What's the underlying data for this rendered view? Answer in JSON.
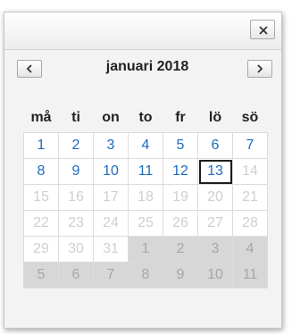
{
  "picker": {
    "month_title": "januari 2018",
    "close_icon": "close-icon",
    "prev_icon": "chevron-left-icon",
    "next_icon": "chevron-right-icon",
    "weekdays": [
      "må",
      "ti",
      "on",
      "to",
      "fr",
      "lö",
      "sö"
    ],
    "weeks": [
      [
        {
          "d": "1",
          "s": "cur"
        },
        {
          "d": "2",
          "s": "cur"
        },
        {
          "d": "3",
          "s": "cur"
        },
        {
          "d": "4",
          "s": "cur"
        },
        {
          "d": "5",
          "s": "cur"
        },
        {
          "d": "6",
          "s": "cur"
        },
        {
          "d": "7",
          "s": "cur"
        }
      ],
      [
        {
          "d": "8",
          "s": "cur"
        },
        {
          "d": "9",
          "s": "cur"
        },
        {
          "d": "10",
          "s": "cur"
        },
        {
          "d": "11",
          "s": "cur"
        },
        {
          "d": "12",
          "s": "cur"
        },
        {
          "d": "13",
          "s": "today"
        },
        {
          "d": "14",
          "s": "dis"
        }
      ],
      [
        {
          "d": "15",
          "s": "dis"
        },
        {
          "d": "16",
          "s": "dis"
        },
        {
          "d": "17",
          "s": "dis"
        },
        {
          "d": "18",
          "s": "dis"
        },
        {
          "d": "19",
          "s": "dis"
        },
        {
          "d": "20",
          "s": "dis"
        },
        {
          "d": "21",
          "s": "dis"
        }
      ],
      [
        {
          "d": "22",
          "s": "dis"
        },
        {
          "d": "23",
          "s": "dis"
        },
        {
          "d": "24",
          "s": "dis"
        },
        {
          "d": "25",
          "s": "dis"
        },
        {
          "d": "26",
          "s": "dis"
        },
        {
          "d": "27",
          "s": "dis"
        },
        {
          "d": "28",
          "s": "dis"
        }
      ],
      [
        {
          "d": "29",
          "s": "dis"
        },
        {
          "d": "30",
          "s": "dis"
        },
        {
          "d": "31",
          "s": "dis"
        },
        {
          "d": "1",
          "s": "other"
        },
        {
          "d": "2",
          "s": "other"
        },
        {
          "d": "3",
          "s": "other"
        },
        {
          "d": "4",
          "s": "other"
        }
      ],
      [
        {
          "d": "5",
          "s": "other"
        },
        {
          "d": "6",
          "s": "other"
        },
        {
          "d": "7",
          "s": "other"
        },
        {
          "d": "8",
          "s": "other"
        },
        {
          "d": "9",
          "s": "other"
        },
        {
          "d": "10",
          "s": "other"
        },
        {
          "d": "11",
          "s": "other"
        }
      ]
    ]
  },
  "colors": {
    "current_month_text": "#1f6bbf",
    "disabled_text": "#cfcfcf",
    "other_month_bg": "#d7d7d7",
    "today_border": "#1e1e1e"
  }
}
